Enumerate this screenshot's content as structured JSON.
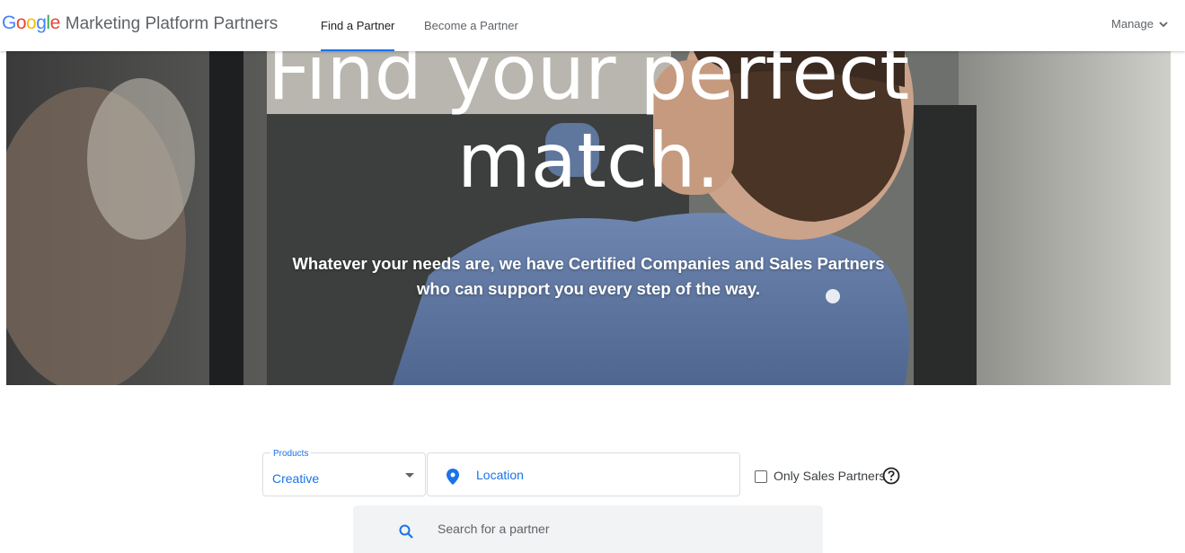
{
  "header": {
    "logo": {
      "letters": [
        "G",
        "o",
        "o",
        "g",
        "l",
        "e"
      ],
      "letter_colors": [
        "#4285F4",
        "#EA4335",
        "#FBBC05",
        "#4285F4",
        "#34A853",
        "#EA4335"
      ]
    },
    "product_name": "Marketing Platform Partners",
    "tabs": [
      {
        "label": "Find a Partner",
        "active": true
      },
      {
        "label": "Become a Partner",
        "active": false
      }
    ],
    "manage_label": "Manage"
  },
  "hero": {
    "title_line1": "Find your perfect",
    "title_line2": "match.",
    "subtitle_line1": "Whatever your needs are, we have Certified Companies and Sales Partners",
    "subtitle_line2": "who can support you every step of the way."
  },
  "search": {
    "products_label": "Products",
    "products_value": "Creative",
    "location_placeholder": "Location",
    "only_sales_partners_label": "Only Sales Partners",
    "only_sales_partners_checked": false,
    "search_placeholder": "Search for a partner"
  },
  "icons": {
    "pin": "location-pin-icon",
    "help": "help-circle-icon",
    "search": "search-icon",
    "chevron": "chevron-down-icon"
  },
  "colors": {
    "accent": "#1a73e8",
    "text_muted": "#5f6368",
    "search_bg": "#f1f3f4"
  }
}
